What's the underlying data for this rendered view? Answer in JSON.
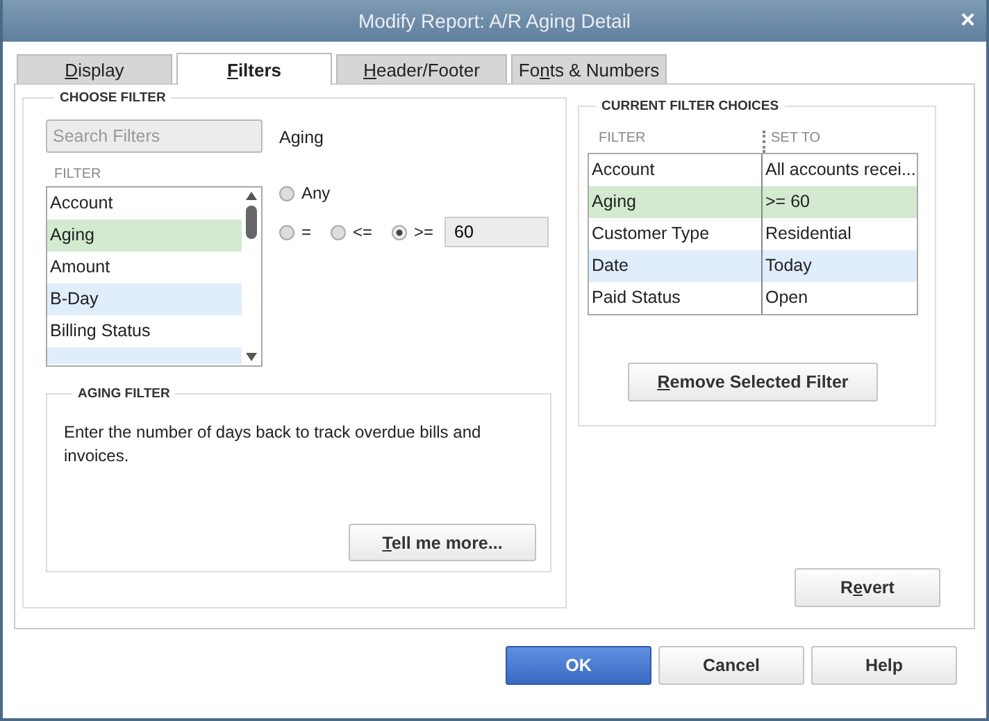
{
  "window": {
    "title": "Modify Report: A/R Aging Detail",
    "close": "×"
  },
  "tabs": [
    {
      "label": {
        "key": "D",
        "post": "isplay"
      },
      "selected": false
    },
    {
      "label": {
        "key": "F",
        "post": "ilters"
      },
      "selected": true
    },
    {
      "label": {
        "key": "H",
        "post": "eader/Footer"
      },
      "selected": false
    },
    {
      "label": {
        "pre": "Fo",
        "key": "n",
        "post": "ts & Numbers"
      },
      "selected": false
    }
  ],
  "choose_filter": {
    "title": "CHOOSE FILTER",
    "search": {
      "placeholder": "Search Filters"
    },
    "list_heading": "FILTER",
    "items": [
      {
        "label": "Account",
        "selected": false
      },
      {
        "label": "Aging",
        "selected": true
      },
      {
        "label": "Amount",
        "selected": false
      },
      {
        "label": "B-Day",
        "selected": false
      },
      {
        "label": "Billing Status",
        "selected": false
      }
    ],
    "detail_title": "Aging",
    "radios": [
      {
        "label": "Any",
        "selected": false
      },
      {
        "label": "=",
        "selected": false
      },
      {
        "label": "<=",
        "selected": false
      },
      {
        "label": ">=",
        "selected": true
      }
    ],
    "days_value": "60"
  },
  "aging_filter": {
    "title": "AGING FILTER",
    "text": "Enter the number of days back to track overdue bills and invoices.",
    "button": {
      "label": {
        "key": "T",
        "post": "ell me more..."
      }
    }
  },
  "current_choices": {
    "title": "CURRENT FILTER CHOICES",
    "columns": [
      "FILTER",
      "SET TO"
    ],
    "rows": [
      {
        "filter": "Account",
        "set_to": "All accounts recei...",
        "selected": false
      },
      {
        "filter": "Aging",
        "set_to": ">= 60",
        "selected": true
      },
      {
        "filter": "Customer Type",
        "set_to": "Residential",
        "selected": false
      },
      {
        "filter": "Date",
        "set_to": "Today",
        "selected": false
      },
      {
        "filter": "Paid Status",
        "set_to": "Open",
        "selected": false
      }
    ],
    "button": {
      "label": {
        "key": "R",
        "post": "emove Selected Filter"
      }
    }
  },
  "revert_button": {
    "label": {
      "pre": "R",
      "key": "e",
      "post": "vert"
    }
  },
  "buttons": [
    {
      "label": "OK",
      "kind": "primary"
    },
    {
      "label": "Cancel",
      "kind": "normal"
    },
    {
      "label": "Help",
      "kind": "normal"
    }
  ]
}
